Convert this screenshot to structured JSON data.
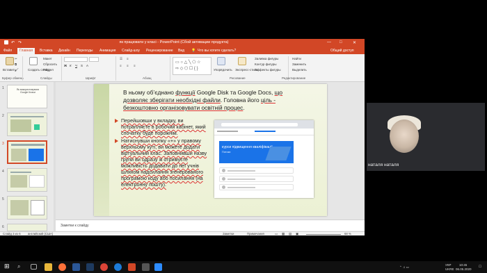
{
  "window": {
    "title": "як працювати у класі - PowerPoint (Сбой активации продукта)",
    "minimize": "—",
    "maximize": "□",
    "close": "✕"
  },
  "menu": {
    "tabs": [
      "Файл",
      "Главная",
      "Вставка",
      "Дизайн",
      "Переходы",
      "Анимация",
      "Слайд-шоу",
      "Рецензирование",
      "Вид"
    ],
    "search": "Что вы хотите сделать?",
    "share": "Общий доступ"
  },
  "ribbon": {
    "paste": "Вставить",
    "cut": "Макет",
    "copy": "Сбросить",
    "format": "Раздел",
    "new_slide": "Создать слайд",
    "clipboard_group": "Буфер обмена",
    "slides_group": "Слайды",
    "font_group": "Шрифт",
    "paragraph_group": "Абзац",
    "drawing_group": "Рисование",
    "editing_group": "Редактирование",
    "arrange": "Упорядочить",
    "quick_styles": "Экспресс-стили",
    "fill": "Заливка фигуры",
    "outline": "Контур фигуры",
    "effects": "Эффекты фигуры",
    "find": "Найти",
    "replace": "Заменить",
    "select": "Выделить"
  },
  "thumbnails": [
    {
      "num": "1",
      "title": "Як використовувати Google Класи"
    },
    {
      "num": "2",
      "title": ""
    },
    {
      "num": "3",
      "title": ""
    },
    {
      "num": "4",
      "title": ""
    },
    {
      "num": "5",
      "title": ""
    },
    {
      "num": "6",
      "title": ""
    }
  ],
  "slide": {
    "title_a": "В ньому об’єднано ",
    "title_b": "функції",
    "title_c": " Google Disk та Google Docs, ",
    "title_d": "що дозволяє зберігати необхідні файли",
    "title_e": ". Головна його ",
    "title_f": "ціль - безкоштовно організовувати освітній процес",
    "title_g": ".",
    "bullet1": "Перейшовши у вкладку, ви потрапляєте в робочий кабінет, який спочатку буде порожнім.",
    "bullet2": "Натиснувши кнопку «+» у правому верхньому куті, ви можете додати віртуальний клас. Заповнивши назву групи ви одразу ж отримуєте можливість додавати до неї учнів шляхом надсилання згенерованого програмою коду або посилання (на електронну пошту).",
    "screenshot_banner": "курси підвищення кваліфікації",
    "screenshot_sub": "Потоки"
  },
  "notes": {
    "label": "Заметки к слайду"
  },
  "status": {
    "slide": "Слайд 3 из 6",
    "lang": "английский (США)",
    "notes": "Заметки",
    "comments": "Примечания",
    "zoom": "68 %"
  },
  "video": {
    "participant": "наталя наталя"
  },
  "taskbar": {
    "lang": "УКР",
    "lang2": "UKRE",
    "time": "10:45",
    "date": "06.05.2020"
  },
  "colors": {
    "accent": "#d24726",
    "banner": "#1a73e8"
  }
}
